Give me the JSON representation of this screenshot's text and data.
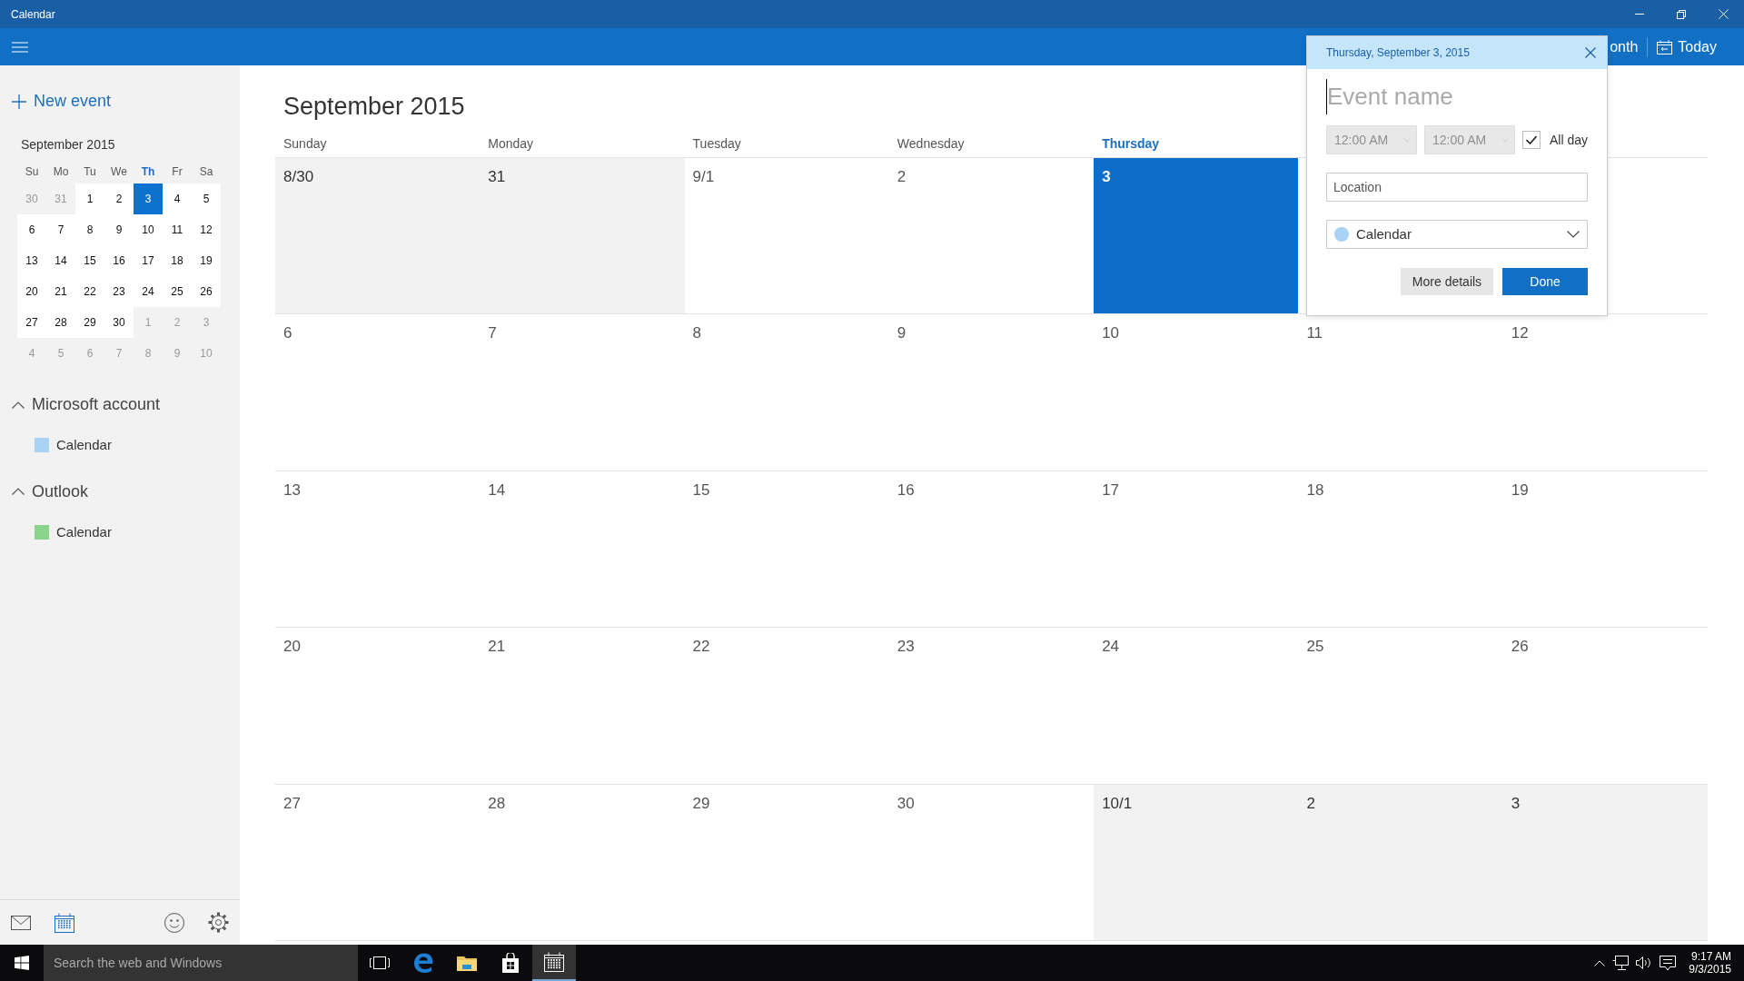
{
  "window": {
    "title": "Calendar"
  },
  "toolbar": {
    "view_button": "onth",
    "today_button": "Today"
  },
  "sidebar": {
    "new_event": "New event",
    "mini_calendar": {
      "title": "September 2015",
      "weekdays": [
        {
          "label": "Su",
          "selected": false
        },
        {
          "label": "Mo",
          "selected": false
        },
        {
          "label": "Tu",
          "selected": false
        },
        {
          "label": "We",
          "selected": false
        },
        {
          "label": "Th",
          "selected": true
        },
        {
          "label": "Fr",
          "selected": false
        },
        {
          "label": "Sa",
          "selected": false
        }
      ],
      "weeks": [
        [
          {
            "day": "30",
            "in_month": false,
            "selected": false
          },
          {
            "day": "31",
            "in_month": false,
            "selected": false
          },
          {
            "day": "1",
            "in_month": true,
            "selected": false
          },
          {
            "day": "2",
            "in_month": true,
            "selected": false
          },
          {
            "day": "3",
            "in_month": true,
            "selected": true
          },
          {
            "day": "4",
            "in_month": true,
            "selected": false
          },
          {
            "day": "5",
            "in_month": true,
            "selected": false
          }
        ],
        [
          {
            "day": "6",
            "in_month": true,
            "selected": false
          },
          {
            "day": "7",
            "in_month": true,
            "selected": false
          },
          {
            "day": "8",
            "in_month": true,
            "selected": false
          },
          {
            "day": "9",
            "in_month": true,
            "selected": false
          },
          {
            "day": "10",
            "in_month": true,
            "selected": false
          },
          {
            "day": "11",
            "in_month": true,
            "selected": false
          },
          {
            "day": "12",
            "in_month": true,
            "selected": false
          }
        ],
        [
          {
            "day": "13",
            "in_month": true,
            "selected": false
          },
          {
            "day": "14",
            "in_month": true,
            "selected": false
          },
          {
            "day": "15",
            "in_month": true,
            "selected": false
          },
          {
            "day": "16",
            "in_month": true,
            "selected": false
          },
          {
            "day": "17",
            "in_month": true,
            "selected": false
          },
          {
            "day": "18",
            "in_month": true,
            "selected": false
          },
          {
            "day": "19",
            "in_month": true,
            "selected": false
          }
        ],
        [
          {
            "day": "20",
            "in_month": true,
            "selected": false
          },
          {
            "day": "21",
            "in_month": true,
            "selected": false
          },
          {
            "day": "22",
            "in_month": true,
            "selected": false
          },
          {
            "day": "23",
            "in_month": true,
            "selected": false
          },
          {
            "day": "24",
            "in_month": true,
            "selected": false
          },
          {
            "day": "25",
            "in_month": true,
            "selected": false
          },
          {
            "day": "26",
            "in_month": true,
            "selected": false
          }
        ],
        [
          {
            "day": "27",
            "in_month": true,
            "selected": false
          },
          {
            "day": "28",
            "in_month": true,
            "selected": false
          },
          {
            "day": "29",
            "in_month": true,
            "selected": false
          },
          {
            "day": "30",
            "in_month": true,
            "selected": false
          },
          {
            "day": "1",
            "in_month": false,
            "selected": false
          },
          {
            "day": "2",
            "in_month": false,
            "selected": false
          },
          {
            "day": "3",
            "in_month": false,
            "selected": false
          }
        ],
        [
          {
            "day": "4",
            "in_month": false,
            "selected": false
          },
          {
            "day": "5",
            "in_month": false,
            "selected": false
          },
          {
            "day": "6",
            "in_month": false,
            "selected": false
          },
          {
            "day": "7",
            "in_month": false,
            "selected": false
          },
          {
            "day": "8",
            "in_month": false,
            "selected": false
          },
          {
            "day": "9",
            "in_month": false,
            "selected": false
          },
          {
            "day": "10",
            "in_month": false,
            "selected": false
          }
        ]
      ]
    },
    "accounts": [
      {
        "name": "Microsoft account",
        "expanded": true,
        "calendars": [
          {
            "name": "Calendar",
            "color": "#a9d2f5"
          }
        ]
      },
      {
        "name": "Outlook",
        "expanded": true,
        "calendars": [
          {
            "name": "Calendar",
            "color": "#8bd48e"
          }
        ]
      }
    ]
  },
  "month_view": {
    "title": "September 2015",
    "weekdays": [
      {
        "label": "Sunday",
        "selected": false
      },
      {
        "label": "Monday",
        "selected": false
      },
      {
        "label": "Tuesday",
        "selected": false
      },
      {
        "label": "Wednesday",
        "selected": false
      },
      {
        "label": "Thursday",
        "selected": true
      }
    ],
    "weeks": [
      [
        {
          "day": "8/30",
          "in_month": false,
          "selected": false
        },
        {
          "day": "31",
          "in_month": false,
          "selected": false
        },
        {
          "day": "9/1",
          "in_month": true,
          "selected": false
        },
        {
          "day": "2",
          "in_month": true,
          "selected": false
        },
        {
          "day": "3",
          "in_month": true,
          "selected": true
        }
      ],
      [
        {
          "day": "6",
          "in_month": true,
          "selected": false
        },
        {
          "day": "7",
          "in_month": true,
          "selected": false
        },
        {
          "day": "8",
          "in_month": true,
          "selected": false
        },
        {
          "day": "9",
          "in_month": true,
          "selected": false
        },
        {
          "day": "10",
          "in_month": true,
          "selected": false
        },
        {
          "day": "11",
          "in_month": true,
          "selected": false
        },
        {
          "day": "12",
          "in_month": true,
          "selected": false
        }
      ],
      [
        {
          "day": "13",
          "in_month": true,
          "selected": false
        },
        {
          "day": "14",
          "in_month": true,
          "selected": false
        },
        {
          "day": "15",
          "in_month": true,
          "selected": false
        },
        {
          "day": "16",
          "in_month": true,
          "selected": false
        },
        {
          "day": "17",
          "in_month": true,
          "selected": false
        },
        {
          "day": "18",
          "in_month": true,
          "selected": false
        },
        {
          "day": "19",
          "in_month": true,
          "selected": false
        }
      ],
      [
        {
          "day": "20",
          "in_month": true,
          "selected": false
        },
        {
          "day": "21",
          "in_month": true,
          "selected": false
        },
        {
          "day": "22",
          "in_month": true,
          "selected": false
        },
        {
          "day": "23",
          "in_month": true,
          "selected": false
        },
        {
          "day": "24",
          "in_month": true,
          "selected": false
        },
        {
          "day": "25",
          "in_month": true,
          "selected": false
        },
        {
          "day": "26",
          "in_month": true,
          "selected": false
        }
      ],
      [
        {
          "day": "27",
          "in_month": true,
          "selected": false
        },
        {
          "day": "28",
          "in_month": true,
          "selected": false
        },
        {
          "day": "29",
          "in_month": true,
          "selected": false
        },
        {
          "day": "30",
          "in_month": true,
          "selected": false
        },
        {
          "day": "10/1",
          "in_month": false,
          "selected": false
        },
        {
          "day": "2",
          "in_month": false,
          "selected": false
        },
        {
          "day": "3",
          "in_month": false,
          "selected": false
        }
      ]
    ]
  },
  "event_popup": {
    "date": "Thursday, September 3, 2015",
    "name_placeholder": "Event name",
    "start_time": {
      "value": "12:00 AM",
      "disabled": true
    },
    "end_time": {
      "value": "12:00 AM",
      "disabled": true
    },
    "all_day": {
      "label": "All day",
      "checked": true
    },
    "location_placeholder": "Location",
    "calendar": {
      "label": "Calendar",
      "color": "#a9d2f5"
    },
    "buttons": [
      {
        "label": "More details",
        "kind": "secondary"
      },
      {
        "label": "Done",
        "kind": "primary"
      }
    ]
  },
  "taskbar": {
    "search_placeholder": "Search the web and Windows",
    "time": "9:17 AM",
    "date": "9/3/2015"
  }
}
